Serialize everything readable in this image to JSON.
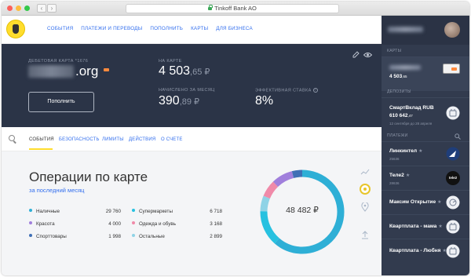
{
  "browser": {
    "url_text": "Tinkoff Bank AO",
    "back_glyph": "‹",
    "forward_glyph": "›"
  },
  "topnav": {
    "links": [
      "СОБЫТИЯ",
      "ПЛАТЕЖИ И ПЕРЕВОДЫ",
      "ПОПОЛНИТЬ",
      "КАРТЫ",
      "ДЛЯ БИЗНЕСА"
    ]
  },
  "hero": {
    "card_label": "ДЕБЕТОВАЯ КАРТА  *1676",
    "card_name_visible": ".org",
    "topup_button": "Пополнить",
    "on_card_label": "НА КАРТЕ",
    "balance_main": "4 503",
    "balance_fraction": ",65 ₽",
    "accrued_label": "НАЧИСЛЕНО ЗА МЕСЯЦ",
    "accrued_main": "390",
    "accrued_fraction": ",89 ₽",
    "rate_label": "ЭФФЕКТИВНАЯ СТАВКА",
    "rate_value": "8%",
    "info_glyph": "?"
  },
  "tabs": {
    "items": [
      "СОБЫТИЯ",
      "БЕЗОПАСНОСТЬ",
      "ЛИМИТЫ",
      "ДЕЙСТВИЯ",
      "О СЧЕТЕ"
    ],
    "active_index": 0
  },
  "operations": {
    "title": "Операции по карте",
    "subtitle": "за последний месяц",
    "total": "48 482 ₽",
    "categories": [
      {
        "name": "Наличные",
        "amount": "29 760",
        "color": "#2eafd6"
      },
      {
        "name": "Красота",
        "amount": "4 000",
        "color": "#a07fdc"
      },
      {
        "name": "Спорттовары",
        "amount": "1 998",
        "color": "#3f6fb5"
      },
      {
        "name": "Супермаркеты",
        "amount": "6 718",
        "color": "#27c1e0"
      },
      {
        "name": "Одежда и обувь",
        "amount": "3 168",
        "color": "#f08aa9"
      },
      {
        "name": "Остальные",
        "amount": "2 899",
        "color": "#8fd3e6"
      }
    ]
  },
  "sidebar": {
    "cards_label": "КАРТЫ",
    "card_balance": "4 503",
    "card_balance_fraction": ",65",
    "deposits_label": "ДЕПОЗИТЫ",
    "deposit_name": "СмартВклад RUB",
    "deposit_amount": "610 642",
    "deposit_amount_fraction": ",47",
    "deposit_note": "12 сентября до 28 апреля",
    "payments_label": "ПЛАТЕЖИ",
    "payments": [
      {
        "name": "Линкинтел",
        "sub": "25636",
        "icon_text": ""
      },
      {
        "name": "Теле2",
        "sub": "28636",
        "icon_text": "tele2"
      },
      {
        "name": "Максим Открытие",
        "sub": "",
        "icon_text": ""
      },
      {
        "name": "Квартплата - мама",
        "sub": "",
        "icon_text": ""
      },
      {
        "name": "Квартплата - Любня",
        "sub": "",
        "icon_text": ""
      }
    ],
    "star_glyph": "★"
  }
}
